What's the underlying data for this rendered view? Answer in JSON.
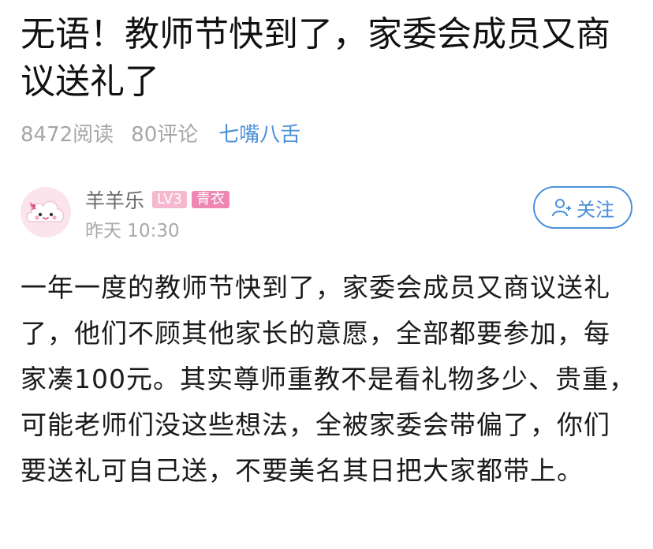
{
  "post": {
    "title": "无语！教师节快到了，家委会成员又商议送礼了",
    "reads": "8472阅读",
    "comments": "80评论",
    "topic": "七嘴八舌"
  },
  "author": {
    "name": "羊羊乐",
    "level": "LV3",
    "role": "青衣",
    "time": "昨天 10:30",
    "follow_label": "关注",
    "avatar_icon": "cloud-girl-avatar"
  },
  "content": {
    "text": "一年一度的教师节快到了，家委会成员又商议送礼了，他们不顾其他家长的意愿，全部都要参加，每家凑100元。其实尊师重教不是看礼物多少、贵重，可能老师们没这些想法，全被家委会带偏了，你们要送礼可自己送，不要美名其日把大家都带上。"
  },
  "colors": {
    "accent": "#4a90d9",
    "topic": "#4a8fd6",
    "badge_level": "#f5b8cf",
    "badge_role": "#ee87b3"
  }
}
